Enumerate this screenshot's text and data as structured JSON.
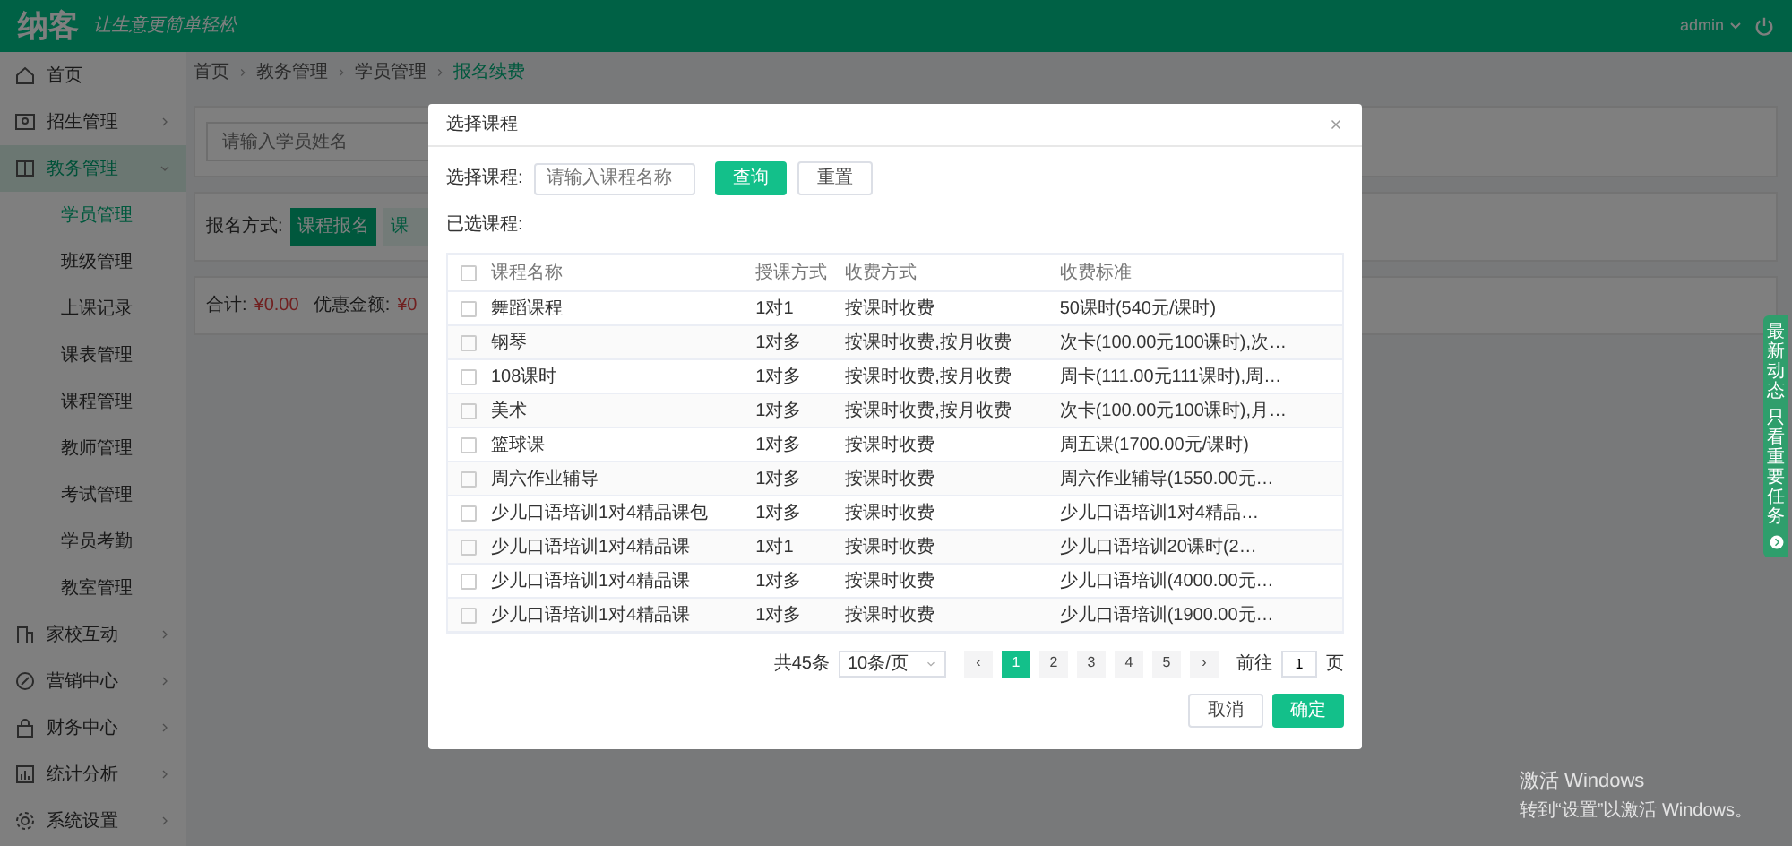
{
  "header": {
    "logo": "纳客",
    "slogan": "让生意更简单轻松",
    "user": "admin"
  },
  "sidebar": {
    "items": [
      {
        "label": "首页",
        "kind": "link"
      },
      {
        "label": "招生管理",
        "kind": "group",
        "expanded": false
      },
      {
        "label": "教务管理",
        "kind": "group",
        "expanded": true,
        "children": [
          {
            "label": "学员管理",
            "selected": true
          },
          {
            "label": "班级管理",
            "selected": false
          },
          {
            "label": "上课记录",
            "selected": false
          },
          {
            "label": "课表管理",
            "selected": false
          },
          {
            "label": "课程管理",
            "selected": false
          },
          {
            "label": "教师管理",
            "selected": false
          },
          {
            "label": "考试管理",
            "selected": false
          },
          {
            "label": "学员考勤",
            "selected": false
          },
          {
            "label": "教室管理",
            "selected": false
          }
        ]
      },
      {
        "label": "家校互动",
        "kind": "group",
        "expanded": false
      },
      {
        "label": "营销中心",
        "kind": "group",
        "expanded": false
      },
      {
        "label": "财务中心",
        "kind": "group",
        "expanded": false
      },
      {
        "label": "统计分析",
        "kind": "group",
        "expanded": false
      },
      {
        "label": "系统设置",
        "kind": "group",
        "expanded": false
      }
    ]
  },
  "breadcrumb": [
    "首页",
    "教务管理",
    "学员管理",
    "报名续费"
  ],
  "page": {
    "search_placeholder": "请输入学员姓名",
    "signup_label": "报名方式:",
    "signup_options": [
      {
        "label": "课程报名",
        "selected": true
      },
      {
        "label": "课",
        "selected": false
      }
    ],
    "totals": [
      {
        "label": "合计:",
        "value": "¥0.00"
      },
      {
        "label": "优惠金额:",
        "value": "¥0"
      }
    ]
  },
  "modal": {
    "title": "选择课程",
    "filter_label": "选择课程:",
    "search_placeholder": "请输入课程名称",
    "query_button": "查询",
    "reset_button": "重置",
    "selected_label": "已选课程:",
    "table": {
      "all_checked": false,
      "columns": [
        "课程名称",
        "授课方式",
        "收费方式",
        "收费标准"
      ],
      "rows": [
        {
          "checked": false,
          "cells": [
            "舞蹈课程",
            "1对1",
            "按课时收费",
            "50课时(540元/课时)"
          ]
        },
        {
          "checked": false,
          "cells": [
            "钢琴",
            "1对多",
            "按课时收费,按月收费",
            "次卡(100.00元100课时),次…"
          ]
        },
        {
          "checked": false,
          "cells": [
            "108课时",
            "1对多",
            "按课时收费,按月收费",
            "周卡(111.00元111课时),周…"
          ]
        },
        {
          "checked": false,
          "cells": [
            "美术",
            "1对多",
            "按课时收费,按月收费",
            "次卡(100.00元100课时),月…"
          ]
        },
        {
          "checked": false,
          "cells": [
            "篮球课",
            "1对多",
            "按课时收费",
            "周五课(1700.00元/课时)"
          ]
        },
        {
          "checked": false,
          "cells": [
            "周六作业辅导",
            "1对多",
            "按课时收费",
            "周六作业辅导(1550.00元…"
          ]
        },
        {
          "checked": false,
          "cells": [
            "少儿口语培训1对4精品课包",
            "1对多",
            "按课时收费",
            "少儿口语培训1对4精品…"
          ]
        },
        {
          "checked": false,
          "cells": [
            "少儿口语培训1对4精品课",
            "1对1",
            "按课时收费",
            "少儿口语培训20课时(2…"
          ]
        },
        {
          "checked": false,
          "cells": [
            "少儿口语培训1对4精品课",
            "1对多",
            "按课时收费",
            "少儿口语培训(4000.00元…"
          ]
        },
        {
          "checked": false,
          "cells": [
            "少儿口语培训1对4精品课",
            "1对多",
            "按课时收费",
            "少儿口语培训(1900.00元…"
          ]
        }
      ]
    },
    "pagination": {
      "total": "共45条",
      "page_size": "10条/页",
      "prev": "‹",
      "next": "›",
      "pages": [
        {
          "label": "1",
          "selected": true
        },
        {
          "label": "2",
          "selected": false
        },
        {
          "label": "3",
          "selected": false
        },
        {
          "label": "4",
          "selected": false
        },
        {
          "label": "5",
          "selected": false
        }
      ],
      "goto_label": "前往",
      "goto_value": "1",
      "page_suffix": "页"
    },
    "cancel_button": "取消",
    "confirm_button": "确定"
  },
  "side_tab": [
    "最新动态",
    "只看重要任务"
  ],
  "os_notice": [
    "激活 Windows",
    "转到“设置”以激活 Windows。"
  ]
}
